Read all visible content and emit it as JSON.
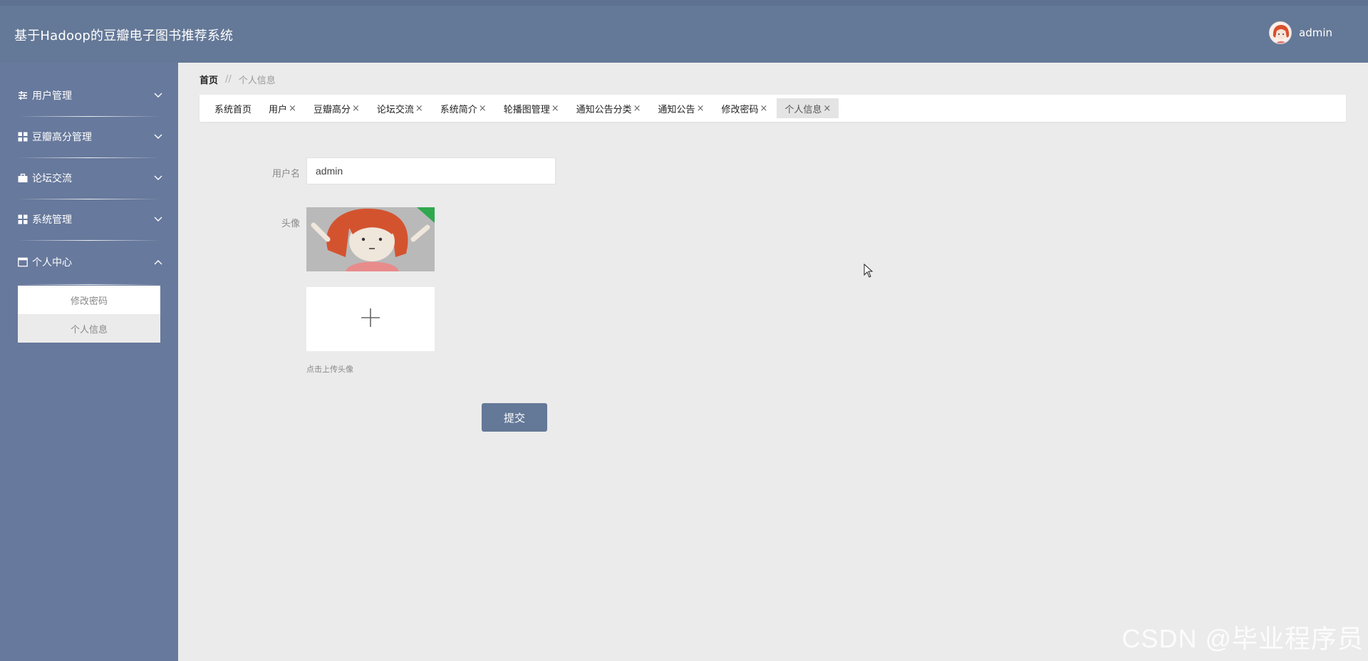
{
  "header": {
    "title": "基于Hadoop的豆瓣电子图书推荐系统",
    "username": "admin",
    "avatar_icon": "user-avatar"
  },
  "sidebar": {
    "groups": [
      {
        "label": "用户管理",
        "icon": "sliders-icon",
        "expanded": false
      },
      {
        "label": "豆瓣高分管理",
        "icon": "grid-icon",
        "expanded": false
      },
      {
        "label": "论坛交流",
        "icon": "briefcase-icon",
        "expanded": false
      },
      {
        "label": "系统管理",
        "icon": "grid-icon",
        "expanded": false
      },
      {
        "label": "个人中心",
        "icon": "window-icon",
        "expanded": true
      }
    ],
    "submenu": [
      {
        "label": "修改密码"
      },
      {
        "label": "个人信息",
        "active": true
      }
    ]
  },
  "breadcrumb": {
    "home": "首页",
    "separator": "//",
    "current": "个人信息"
  },
  "tabs": [
    {
      "label": "系统首页",
      "closable": false
    },
    {
      "label": "用户",
      "closable": true
    },
    {
      "label": "豆瓣高分",
      "closable": true
    },
    {
      "label": "论坛交流",
      "closable": true
    },
    {
      "label": "系统简介",
      "closable": true
    },
    {
      "label": "轮播图管理",
      "closable": true
    },
    {
      "label": "通知公告分类",
      "closable": true
    },
    {
      "label": "通知公告",
      "closable": true
    },
    {
      "label": "修改密码",
      "closable": true
    },
    {
      "label": "个人信息",
      "closable": true,
      "active": true
    }
  ],
  "close_glyph": "×",
  "form": {
    "username_label": "用户名",
    "username_value": "admin",
    "avatar_label": "头像",
    "upload_tip": "点击上传头像",
    "submit_label": "提交"
  },
  "watermark": "CSDN @毕业程序员",
  "colors": {
    "primary": "#647897",
    "sidebar": "#67799c",
    "background": "#ebebeb"
  }
}
